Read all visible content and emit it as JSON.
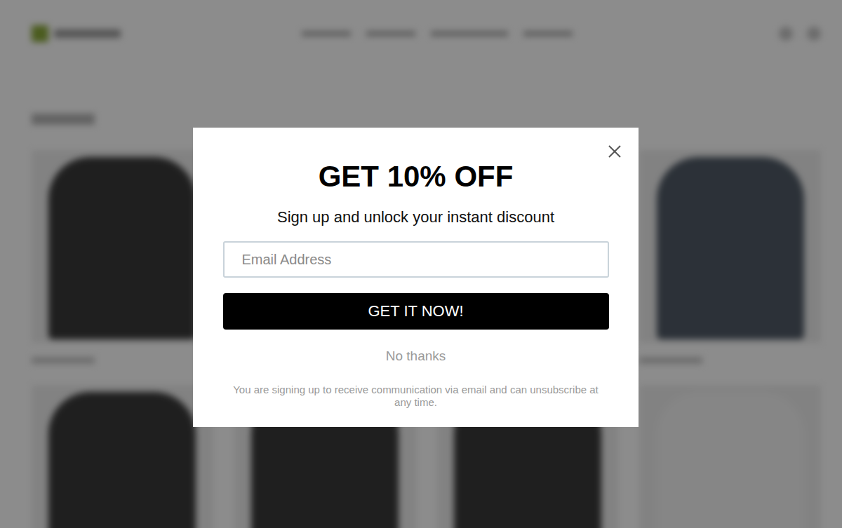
{
  "dialog": {
    "title": "GET 10% OFF",
    "subtitle": "Sign up and unlock your instant discount",
    "email": {
      "placeholder": "Email Address",
      "value": ""
    },
    "submit": "GET IT NOW!",
    "decline": "No thanks",
    "disclaimer": "You are signing up to receive communication via email and can unsubscribe at any time."
  }
}
